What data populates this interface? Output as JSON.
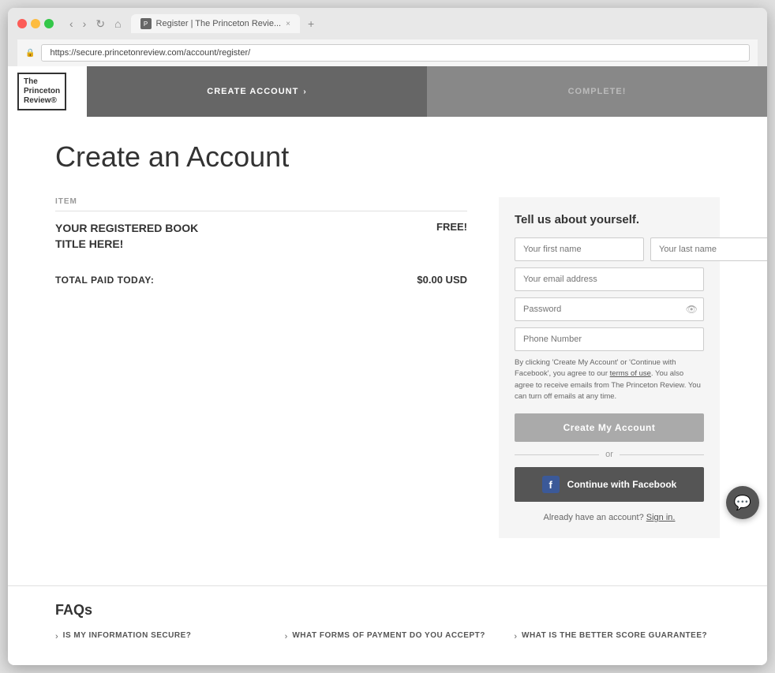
{
  "browser": {
    "tab_label": "Register | The Princeton Revie...",
    "address": "https://secure.princetonreview.com/account/register/",
    "close": "×",
    "favicon": "P"
  },
  "header": {
    "logo_line1": "The",
    "logo_line2": "Princeton",
    "logo_line3": "Review®",
    "step1_label": "CREATE ACCOUNT",
    "step1_arrow": "›",
    "step2_label": "COMPLETE!"
  },
  "page": {
    "title": "Create an Account",
    "item_column": "ITEM",
    "book_title_line1": "YOUR REGISTERED BOOK",
    "book_title_line2": "TITLE HERE!",
    "price_label": "FREE!",
    "total_label": "TOTAL PAID TODAY:",
    "total_amount": "$0.00 USD"
  },
  "form": {
    "section_title": "Tell us about yourself.",
    "first_name_placeholder": "Your first name",
    "last_name_placeholder": "Your last name",
    "email_placeholder": "Your email address",
    "password_placeholder": "Password",
    "phone_placeholder": "Phone Number",
    "terms_text": "By clicking 'Create My Account' or 'Continue with Facebook', you agree to our terms of use. You also agree to receive emails from The Princeton Review. You can turn off emails at any time.",
    "terms_link": "terms of use",
    "create_button": "Create My Account",
    "or_label": "or",
    "facebook_button": "Continue with Facebook",
    "already_text": "Already have an account?",
    "signin_link": "Sign in."
  },
  "faqs": {
    "title": "FAQs",
    "items": [
      {
        "label": "IS MY INFORMATION SECURE?"
      },
      {
        "label": "WHAT FORMS OF PAYMENT DO YOU ACCEPT?"
      },
      {
        "label": "WHAT IS THE BETTER SCORE GUARANTEE?"
      }
    ]
  },
  "chat": {
    "icon": "💬"
  }
}
